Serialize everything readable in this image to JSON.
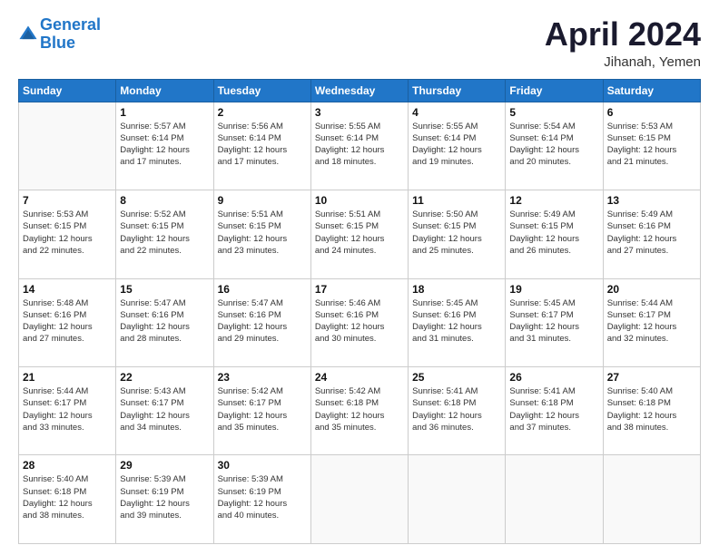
{
  "header": {
    "logo_line1": "General",
    "logo_line2": "Blue",
    "month_title": "April 2024",
    "location": "Jihanah, Yemen"
  },
  "weekdays": [
    "Sunday",
    "Monday",
    "Tuesday",
    "Wednesday",
    "Thursday",
    "Friday",
    "Saturday"
  ],
  "weeks": [
    [
      {
        "day": "",
        "info": ""
      },
      {
        "day": "1",
        "info": "Sunrise: 5:57 AM\nSunset: 6:14 PM\nDaylight: 12 hours\nand 17 minutes."
      },
      {
        "day": "2",
        "info": "Sunrise: 5:56 AM\nSunset: 6:14 PM\nDaylight: 12 hours\nand 17 minutes."
      },
      {
        "day": "3",
        "info": "Sunrise: 5:55 AM\nSunset: 6:14 PM\nDaylight: 12 hours\nand 18 minutes."
      },
      {
        "day": "4",
        "info": "Sunrise: 5:55 AM\nSunset: 6:14 PM\nDaylight: 12 hours\nand 19 minutes."
      },
      {
        "day": "5",
        "info": "Sunrise: 5:54 AM\nSunset: 6:14 PM\nDaylight: 12 hours\nand 20 minutes."
      },
      {
        "day": "6",
        "info": "Sunrise: 5:53 AM\nSunset: 6:15 PM\nDaylight: 12 hours\nand 21 minutes."
      }
    ],
    [
      {
        "day": "7",
        "info": "Sunrise: 5:53 AM\nSunset: 6:15 PM\nDaylight: 12 hours\nand 22 minutes."
      },
      {
        "day": "8",
        "info": "Sunrise: 5:52 AM\nSunset: 6:15 PM\nDaylight: 12 hours\nand 22 minutes."
      },
      {
        "day": "9",
        "info": "Sunrise: 5:51 AM\nSunset: 6:15 PM\nDaylight: 12 hours\nand 23 minutes."
      },
      {
        "day": "10",
        "info": "Sunrise: 5:51 AM\nSunset: 6:15 PM\nDaylight: 12 hours\nand 24 minutes."
      },
      {
        "day": "11",
        "info": "Sunrise: 5:50 AM\nSunset: 6:15 PM\nDaylight: 12 hours\nand 25 minutes."
      },
      {
        "day": "12",
        "info": "Sunrise: 5:49 AM\nSunset: 6:15 PM\nDaylight: 12 hours\nand 26 minutes."
      },
      {
        "day": "13",
        "info": "Sunrise: 5:49 AM\nSunset: 6:16 PM\nDaylight: 12 hours\nand 27 minutes."
      }
    ],
    [
      {
        "day": "14",
        "info": "Sunrise: 5:48 AM\nSunset: 6:16 PM\nDaylight: 12 hours\nand 27 minutes."
      },
      {
        "day": "15",
        "info": "Sunrise: 5:47 AM\nSunset: 6:16 PM\nDaylight: 12 hours\nand 28 minutes."
      },
      {
        "day": "16",
        "info": "Sunrise: 5:47 AM\nSunset: 6:16 PM\nDaylight: 12 hours\nand 29 minutes."
      },
      {
        "day": "17",
        "info": "Sunrise: 5:46 AM\nSunset: 6:16 PM\nDaylight: 12 hours\nand 30 minutes."
      },
      {
        "day": "18",
        "info": "Sunrise: 5:45 AM\nSunset: 6:16 PM\nDaylight: 12 hours\nand 31 minutes."
      },
      {
        "day": "19",
        "info": "Sunrise: 5:45 AM\nSunset: 6:17 PM\nDaylight: 12 hours\nand 31 minutes."
      },
      {
        "day": "20",
        "info": "Sunrise: 5:44 AM\nSunset: 6:17 PM\nDaylight: 12 hours\nand 32 minutes."
      }
    ],
    [
      {
        "day": "21",
        "info": "Sunrise: 5:44 AM\nSunset: 6:17 PM\nDaylight: 12 hours\nand 33 minutes."
      },
      {
        "day": "22",
        "info": "Sunrise: 5:43 AM\nSunset: 6:17 PM\nDaylight: 12 hours\nand 34 minutes."
      },
      {
        "day": "23",
        "info": "Sunrise: 5:42 AM\nSunset: 6:17 PM\nDaylight: 12 hours\nand 35 minutes."
      },
      {
        "day": "24",
        "info": "Sunrise: 5:42 AM\nSunset: 6:18 PM\nDaylight: 12 hours\nand 35 minutes."
      },
      {
        "day": "25",
        "info": "Sunrise: 5:41 AM\nSunset: 6:18 PM\nDaylight: 12 hours\nand 36 minutes."
      },
      {
        "day": "26",
        "info": "Sunrise: 5:41 AM\nSunset: 6:18 PM\nDaylight: 12 hours\nand 37 minutes."
      },
      {
        "day": "27",
        "info": "Sunrise: 5:40 AM\nSunset: 6:18 PM\nDaylight: 12 hours\nand 38 minutes."
      }
    ],
    [
      {
        "day": "28",
        "info": "Sunrise: 5:40 AM\nSunset: 6:18 PM\nDaylight: 12 hours\nand 38 minutes."
      },
      {
        "day": "29",
        "info": "Sunrise: 5:39 AM\nSunset: 6:19 PM\nDaylight: 12 hours\nand 39 minutes."
      },
      {
        "day": "30",
        "info": "Sunrise: 5:39 AM\nSunset: 6:19 PM\nDaylight: 12 hours\nand 40 minutes."
      },
      {
        "day": "",
        "info": ""
      },
      {
        "day": "",
        "info": ""
      },
      {
        "day": "",
        "info": ""
      },
      {
        "day": "",
        "info": ""
      }
    ]
  ]
}
